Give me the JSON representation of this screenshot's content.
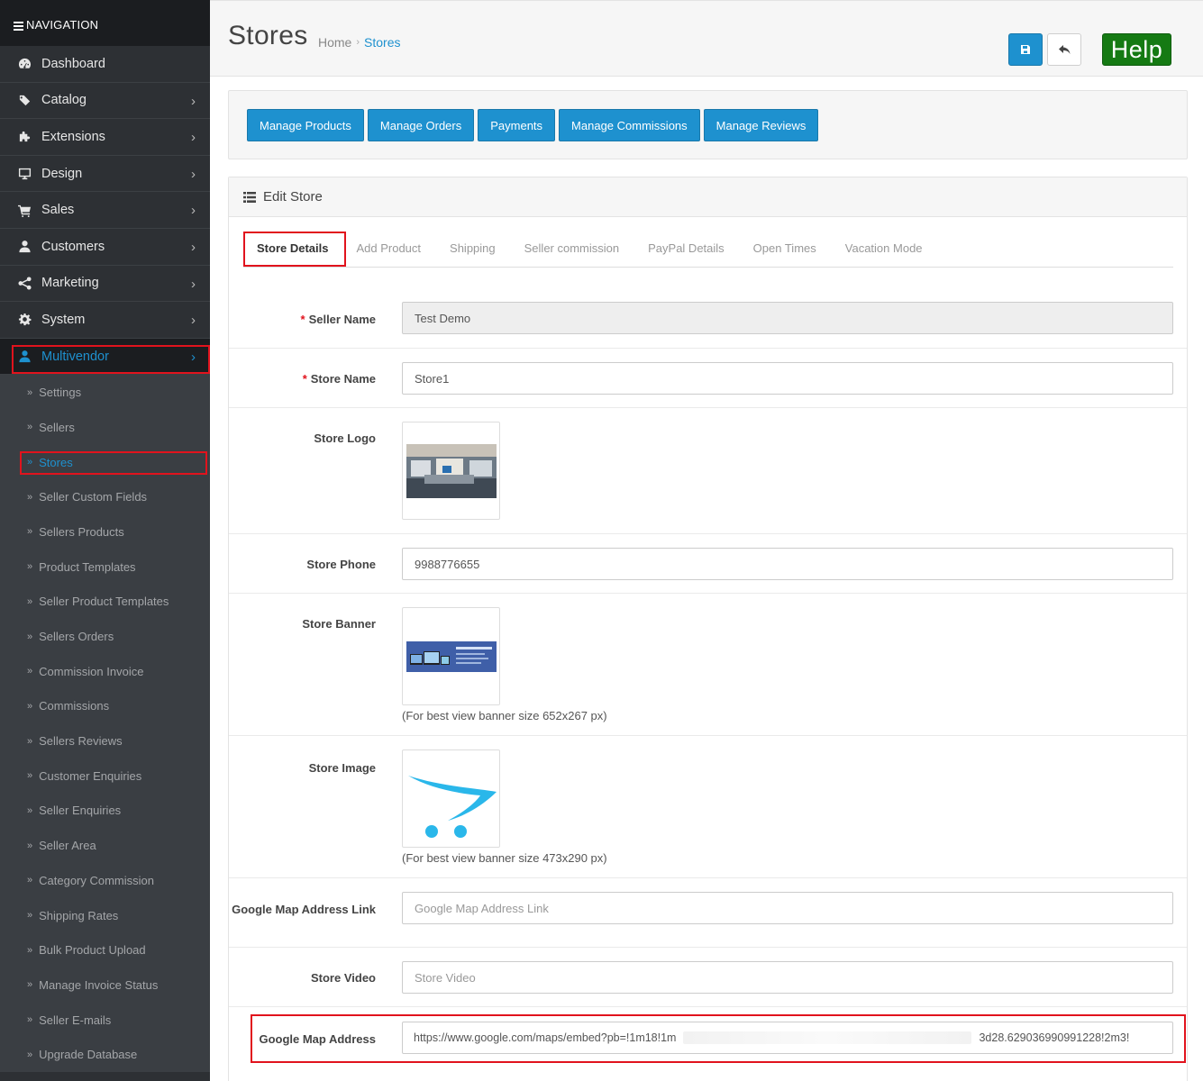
{
  "sidebar": {
    "header": "NAVIGATION",
    "menu": [
      {
        "label": "Dashboard",
        "icon": "dashboard-icon"
      },
      {
        "label": "Catalog",
        "icon": "tags-icon",
        "chevron": "›"
      },
      {
        "label": "Extensions",
        "icon": "puzzle-icon",
        "chevron": "›"
      },
      {
        "label": "Design",
        "icon": "monitor-icon",
        "chevron": "›"
      },
      {
        "label": "Sales",
        "icon": "cart-icon",
        "chevron": "›"
      },
      {
        "label": "Customers",
        "icon": "user-icon",
        "chevron": "›"
      },
      {
        "label": "Marketing",
        "icon": "share-icon",
        "chevron": "›"
      },
      {
        "label": "System",
        "icon": "gear-icon",
        "chevron": "›"
      },
      {
        "label": "Multivendor",
        "icon": "user-icon",
        "chevron": "›"
      }
    ],
    "submenu": [
      "Settings",
      "Sellers",
      "Stores",
      "Seller Custom Fields",
      "Sellers Products",
      "Product Templates",
      "Seller Product Templates",
      "Sellers Orders",
      "Commission Invoice",
      "Commissions",
      "Sellers Reviews",
      "Customer Enquiries",
      "Seller Enquiries",
      "Seller Area",
      "Category Commission",
      "Shipping Rates",
      "Bulk Product Upload",
      "Manage Invoice Status",
      "Seller E-mails",
      "Upgrade Database"
    ],
    "submenu_bullet": "»"
  },
  "header": {
    "title": "Stores",
    "breadcrumb": {
      "home": "Home",
      "sep": "›",
      "current": "Stores"
    },
    "help_label": "Help"
  },
  "actions": [
    "Manage Products",
    "Manage Orders",
    "Payments",
    "Manage Commissions",
    "Manage Reviews"
  ],
  "edit": {
    "heading": "Edit Store",
    "tabs": [
      "Store Details",
      "Add Product",
      "Shipping",
      "Seller commission",
      "PayPal Details",
      "Open Times",
      "Vacation Mode"
    ],
    "required_mark": "*",
    "fields": {
      "seller_name": {
        "label": "Seller Name",
        "value": "Test Demo"
      },
      "store_name": {
        "label": "Store Name",
        "value": "Store1"
      },
      "store_logo": {
        "label": "Store Logo"
      },
      "store_phone": {
        "label": "Store Phone",
        "value": "9988776655"
      },
      "store_banner": {
        "label": "Store Banner",
        "hint": "(For best view banner size 652x267 px)"
      },
      "store_image": {
        "label": "Store Image",
        "hint": "(For best view banner size 473x290 px)"
      },
      "map_link": {
        "label": "Google Map Address Link",
        "placeholder": "Google Map Address Link"
      },
      "store_video": {
        "label": "Store Video",
        "placeholder": "Store Video"
      },
      "map_address": {
        "label": "Google Map Address",
        "value_start": "https://www.google.com/maps/embed?pb=!1m18!1m",
        "value_end": "3d28.629036990991228!2m3!"
      }
    }
  },
  "colors": {
    "primary": "#1e91cf",
    "help": "#157a13",
    "sidebar": "#2d3034",
    "highlight": "#e1131d"
  }
}
